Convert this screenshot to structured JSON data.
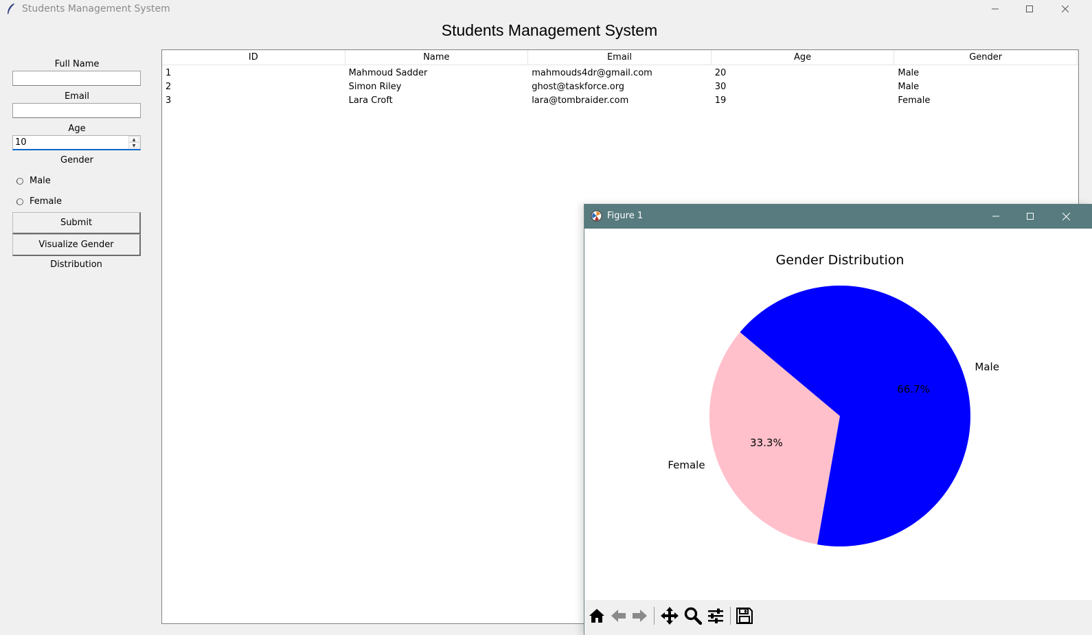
{
  "window": {
    "title": "Students Management System",
    "heading": "Students Management System"
  },
  "form": {
    "full_name_label": "Full Name",
    "full_name_value": "",
    "email_label": "Email",
    "email_value": "",
    "age_label": "Age",
    "age_value": "10",
    "gender_label": "Gender",
    "gender_options": [
      "Male",
      "Female"
    ],
    "submit_label": "Submit",
    "visualize_label": "Visualize Gender Distribution"
  },
  "table": {
    "columns": [
      "ID",
      "Name",
      "Email",
      "Age",
      "Gender"
    ],
    "rows": [
      [
        "1",
        "Mahmoud Sadder",
        "mahmouds4dr@gmail.com",
        "20",
        "Male"
      ],
      [
        "2",
        "Simon Riley",
        "ghost@taskforce.org",
        "30",
        "Male"
      ],
      [
        "3",
        "Lara Croft",
        "lara@tombraider.com",
        "19",
        "Female"
      ]
    ]
  },
  "figure": {
    "window_title": "Figure 1",
    "toolbar_icons": [
      "home-icon",
      "back-arrow-icon",
      "forward-arrow-icon",
      "pan-icon",
      "zoom-icon",
      "configure-subplots-icon",
      "save-icon"
    ]
  },
  "chart_data": {
    "type": "pie",
    "title": "Gender Distribution",
    "labels": [
      "Female",
      "Male"
    ],
    "values": [
      1,
      2
    ],
    "percent_labels": [
      "33.3%",
      "66.7%"
    ],
    "colors": [
      "#ffc0cb",
      "#0000ff"
    ],
    "startangle": 140
  }
}
